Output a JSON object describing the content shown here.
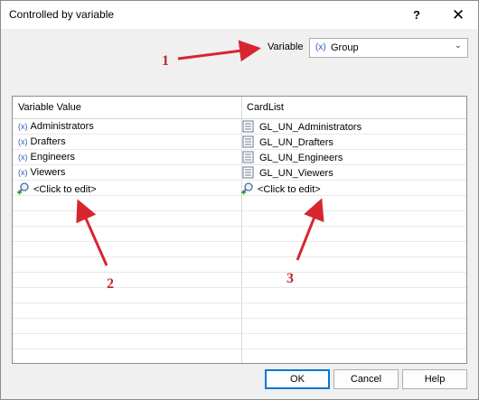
{
  "dialog": {
    "title": "Controlled by variable",
    "help_label": "?",
    "close_label": "✕"
  },
  "variable": {
    "label": "Variable",
    "prefix": "(x)",
    "value": "Group"
  },
  "grid": {
    "col1_header": "Variable Value",
    "col2_header": "CardList",
    "rows": [
      {
        "var_prefix": "(x)",
        "value": "Administrators",
        "card": "GL_UN_Administrators"
      },
      {
        "var_prefix": "(x)",
        "value": "Drafters",
        "card": "GL_UN_Drafters"
      },
      {
        "var_prefix": "(x)",
        "value": "Engineers",
        "card": "GL_UN_Engineers"
      },
      {
        "var_prefix": "(x)",
        "value": "Viewers",
        "card": "GL_UN_Viewers"
      }
    ],
    "edit_row": {
      "col1": "<Click to edit>",
      "col2": "<Click to edit>"
    }
  },
  "buttons": {
    "ok": "OK",
    "cancel": "Cancel",
    "help": "Help"
  },
  "annotations": {
    "a1": "1",
    "a2": "2",
    "a3": "3",
    "color": "#d7262e"
  }
}
